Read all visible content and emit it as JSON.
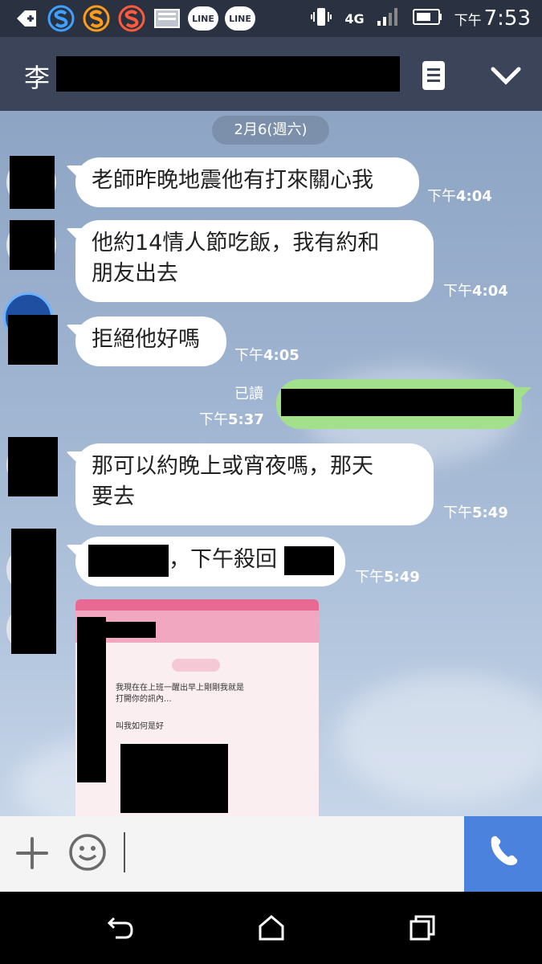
{
  "status_bar": {
    "clock_ampm": "下午",
    "clock_time": "7:53",
    "network": "4G",
    "icons": [
      "add-icon",
      "s-app-icon-blue",
      "s-app-icon-orange",
      "s-app-icon-red",
      "image-icon",
      "line-icon",
      "line-icon",
      "vibrate-icon",
      "signal-icon",
      "battery-icon"
    ],
    "line_badge": "LINE"
  },
  "header": {
    "contact_name_visible": "李",
    "menu_icon": "note-icon",
    "collapse_icon": "chevron-down-icon"
  },
  "chat": {
    "date_label": "2月6(週六)",
    "messages": [
      {
        "direction": "in",
        "text": "老師昨晚地震他有打來關心我",
        "ampm": "下午",
        "time": "4:04"
      },
      {
        "direction": "in",
        "text_line1": "他約14情人節吃飯，我有約和",
        "text_line2": "朋友出去",
        "ampm": "下午",
        "time": "4:04"
      },
      {
        "direction": "in",
        "text": "拒絕他好嗎",
        "ampm": "下午",
        "time": "4:05"
      },
      {
        "direction": "out",
        "read_label": "已讀",
        "ampm": "下午",
        "time": "5:37"
      },
      {
        "direction": "in",
        "text_line1": "那可以約晚上或宵夜嗎，那天",
        "text_line2": "要去",
        "ampm": "下午",
        "time": "5:49"
      },
      {
        "direction": "in",
        "text": "，下午殺回",
        "ampm": "下午",
        "time": "5:49"
      }
    ],
    "photo_text_line1": "我現在在上班一醒出早上剛剛我就是",
    "photo_text_line2": "打開你的訊內...",
    "photo_text_line3": "叫我如何是好"
  },
  "input_bar": {
    "plus_icon": "plus-icon",
    "emoji_icon": "emoji-icon",
    "call_icon": "phone-icon"
  },
  "nav_bar": {
    "icons": [
      "back-icon",
      "home-icon",
      "recents-icon"
    ]
  },
  "colors": {
    "header_bg": "#3b4459",
    "outgoing_bubble": "#a3e08c",
    "call_button": "#4a82de"
  }
}
